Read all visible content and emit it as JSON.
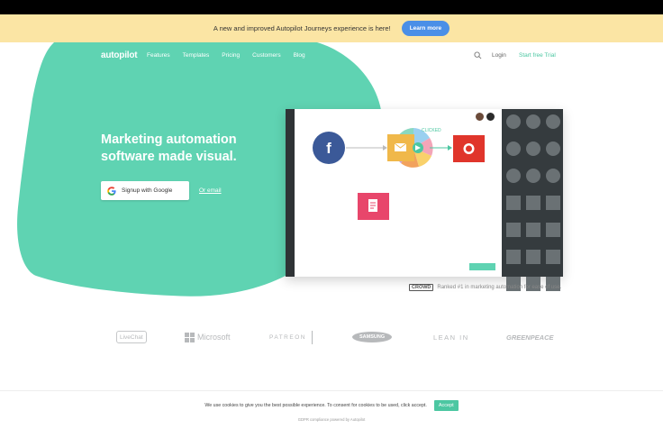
{
  "announcement": {
    "text": "A new and improved Autopilot Journeys experience is here!",
    "button": "Learn more"
  },
  "nav": {
    "logo": "autopilot",
    "links": [
      "Features",
      "Templates",
      "Pricing",
      "Customers",
      "Blog"
    ],
    "search_icon": "search-icon",
    "login": "Login",
    "trial": "Start free Trial"
  },
  "hero": {
    "title": "Marketing automation software made visual.",
    "google_button": "Signup with Google",
    "or_email": "Or email"
  },
  "app_preview": {
    "clicked_label": "CLICKED"
  },
  "badge": {
    "logo_text": "CROWD",
    "text": "Ranked #1 in marketing automation for ease of use."
  },
  "customers": [
    "LiveChat",
    "Microsoft",
    "PATREON",
    "SAMSUNG",
    "LEAN IN",
    "GREENPEACE"
  ],
  "cookie": {
    "text": "We use cookies to give you the best possible experience. To consent for cookies to be used, click accept.",
    "accept": "Accept",
    "footer": "GDPR compliance powered by Autopilot"
  },
  "colors": {
    "brand_green": "#5fd3b2",
    "announce_bg": "#fbe5a4",
    "announce_button": "#4a8fe7",
    "facebook_blue": "#3b5998",
    "email_yellow": "#f0b84a",
    "red_node": "#e0352b",
    "pink_node": "#e8466b"
  }
}
